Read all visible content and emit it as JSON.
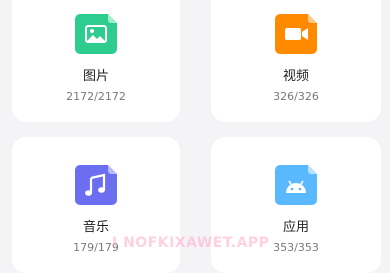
{
  "categories": [
    {
      "label": "图片",
      "count": "2172/2172",
      "icon": "image-icon",
      "color": "#2ecc8f"
    },
    {
      "label": "视频",
      "count": "326/326",
      "icon": "video-icon",
      "color": "#ff8a00"
    },
    {
      "label": "音乐",
      "count": "179/179",
      "icon": "music-icon",
      "color": "#6b6ef0"
    },
    {
      "label": "应用",
      "count": "353/353",
      "icon": "android-icon",
      "color": "#5ab8ff"
    }
  ],
  "watermark": {
    "text": "I NOFKIXAWET.APP"
  }
}
